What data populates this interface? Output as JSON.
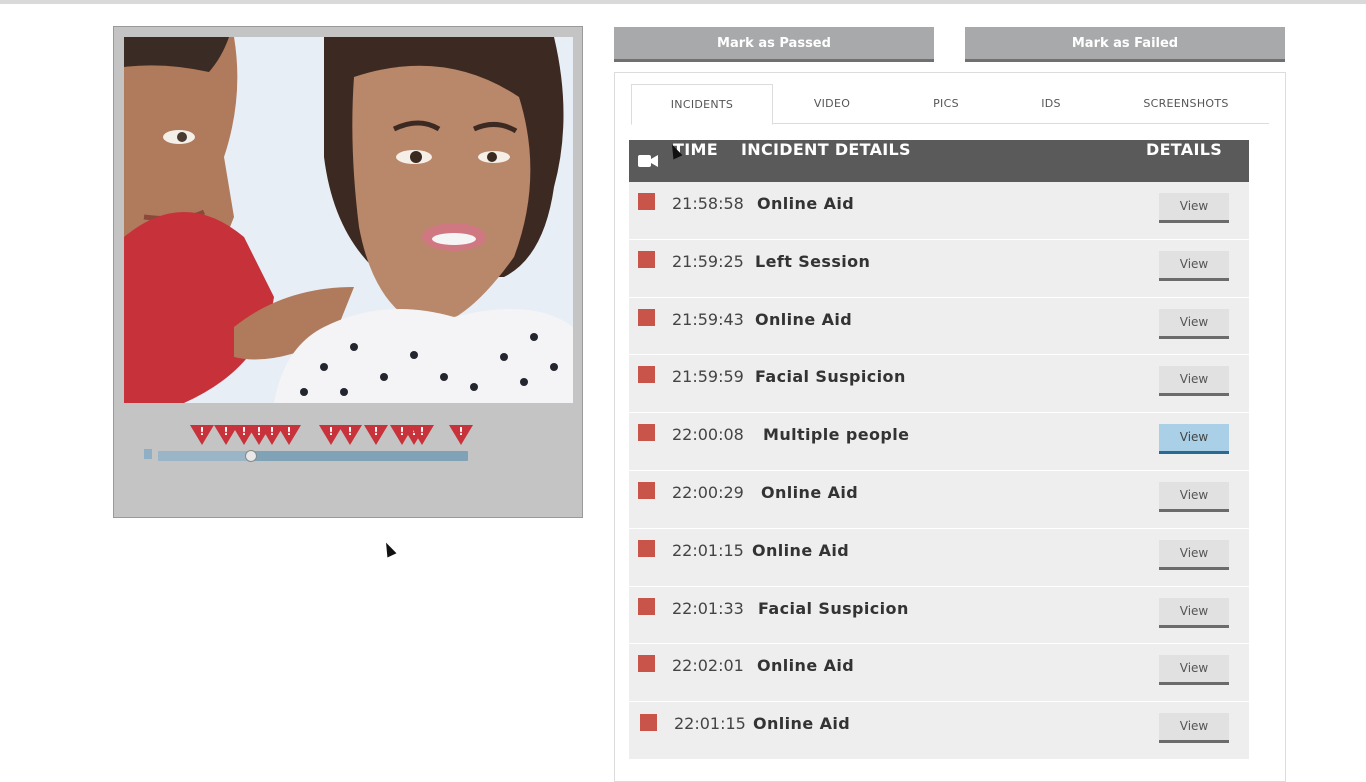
{
  "actions": {
    "pass_label": "Mark as Passed",
    "fail_label": "Mark as Failed"
  },
  "tabs": [
    {
      "label": "INCIDENTS",
      "active": true
    },
    {
      "label": "VIDEO",
      "active": false
    },
    {
      "label": "PICS",
      "active": false
    },
    {
      "label": "IDS",
      "active": false
    },
    {
      "label": "SCREENSHOTS",
      "active": false
    }
  ],
  "table": {
    "headers": {
      "time": "TIME",
      "details": "INCIDENT DETAILS",
      "action": "DETAILS"
    },
    "camera_icon": "video-camera-icon",
    "incident_color": "#c9554a",
    "rows": [
      {
        "time": "21:58:58",
        "detail": "Online Aid",
        "button": "View",
        "highlighted": false
      },
      {
        "time": "21:59:25",
        "detail": "Left Session",
        "button": "View",
        "highlighted": false
      },
      {
        "time": "21:59:43",
        "detail": "Online Aid",
        "button": "View",
        "highlighted": false
      },
      {
        "time": "21:59:59",
        "detail": "Facial Suspicion",
        "button": "View",
        "highlighted": false
      },
      {
        "time": "22:00:08",
        "detail": "Multiple people",
        "button": "View",
        "highlighted": true
      },
      {
        "time": "22:00:29",
        "detail": "Online Aid",
        "button": "View",
        "highlighted": false
      },
      {
        "time": "22:01:15",
        "detail": "Online Aid",
        "button": "View",
        "highlighted": false
      },
      {
        "time": "22:01:33",
        "detail": "Facial Suspicion",
        "button": "View",
        "highlighted": false
      },
      {
        "time": "22:02:01",
        "detail": "Online Aid",
        "button": "View",
        "highlighted": false
      },
      {
        "time": "22:01:15",
        "detail": "Online Aid",
        "button": "View",
        "highlighted": false
      }
    ]
  },
  "player": {
    "progress_fraction": 0.3,
    "marker_glyph": "!",
    "marker_icon": "warning-triangle-icon",
    "marker_color": "#c8323a",
    "marker_count": 13
  }
}
